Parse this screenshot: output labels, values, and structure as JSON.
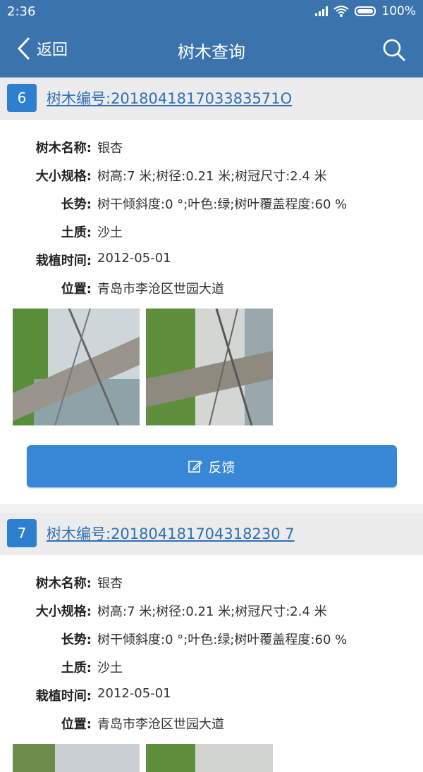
{
  "status": {
    "time": "2:36",
    "battery": "100%"
  },
  "nav": {
    "back_label": "返回",
    "title": "树木查询"
  },
  "labels": {
    "name": "树木名称:",
    "size": "大小规格:",
    "growth": "长势:",
    "soil": "土质:",
    "planted": "栽植时间:",
    "location": "位置:",
    "feedback": "反馈"
  },
  "cards": [
    {
      "index": "6",
      "tree_id": "树木编号:201804181703383571O",
      "name": "银杏",
      "size": "树高:7 米;树径:0.21 米;树冠尺寸:2.4 米",
      "growth": "树干倾斜度:0 °;叶色:绿;树叶覆盖程度:60 %",
      "soil": "沙土",
      "planted": "2012-05-01",
      "location": "青岛市李沧区世园大道"
    },
    {
      "index": "7",
      "tree_id": "树木编号:201804181704318230 7",
      "name": "银杏",
      "size": "树高:7 米;树径:0.21 米;树冠尺寸:2.4 米",
      "growth": "树干倾斜度:0 °;叶色:绿;树叶覆盖程度:60 %",
      "soil": "沙土",
      "planted": "2012-05-01",
      "location": "青岛市李沧区世园大道"
    }
  ]
}
